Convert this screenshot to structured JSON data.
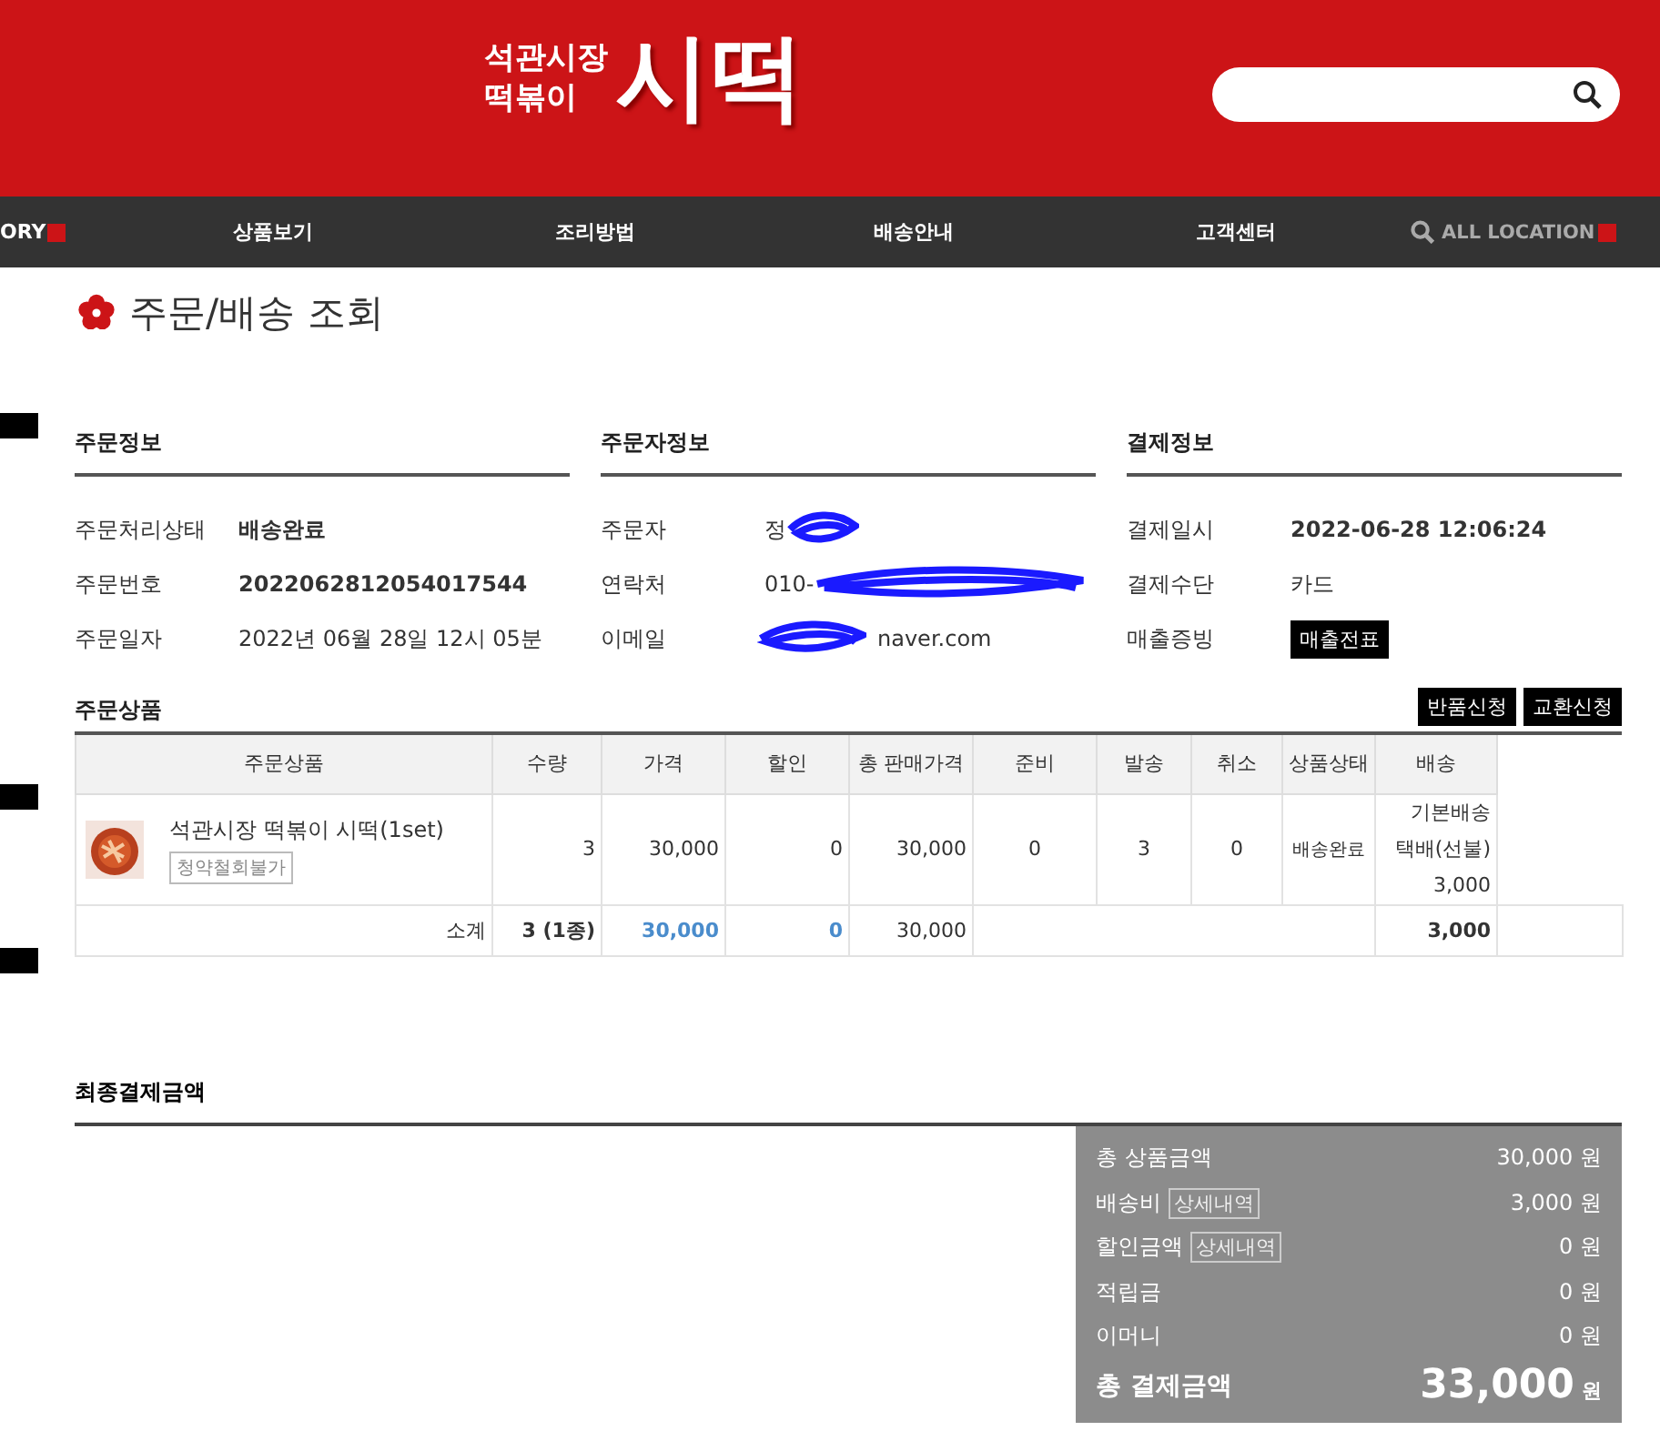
{
  "header": {
    "logo": {
      "small_line_1": "석관시장",
      "small_line_2": "떡볶이",
      "big": "시떡"
    }
  },
  "nav": {
    "left_cut": "ORY",
    "items": [
      "상품보기",
      "조리방법",
      "배송안내",
      "고객센터"
    ],
    "location": "ALL LOCATION"
  },
  "page_title": "주문/배송 조회",
  "info_sections": [
    {
      "title": "주문정보",
      "rows": [
        {
          "label": "주문처리상태",
          "value": "배송완료",
          "kind": "bold"
        },
        {
          "label": "주문번호",
          "value": "2022062812054017544",
          "kind": "bold"
        },
        {
          "label": "주문일자",
          "value": "2022년 06월 28일 12시 05분",
          "kind": "plain"
        }
      ]
    },
    {
      "title": "주문자정보",
      "rows": [
        {
          "label": "주문자",
          "value": "정",
          "kind": "redacted"
        },
        {
          "label": "연락처",
          "value": "010-",
          "kind": "redacted"
        },
        {
          "label": "이메일",
          "value": "naver.com",
          "kind": "redacted_before"
        }
      ]
    },
    {
      "title": "결제정보",
      "rows": [
        {
          "label": "결제일시",
          "value": "2022-06-28 12:06:24",
          "kind": "bold"
        },
        {
          "label": "결제수단",
          "value": "카드",
          "kind": "plain"
        },
        {
          "label": "매출증빙",
          "value": "매출전표",
          "kind": "button"
        }
      ]
    }
  ],
  "products": {
    "title": "주문상품",
    "buttons": [
      "반품신청",
      "교환신청"
    ],
    "columns": [
      "주문상품",
      "수량",
      "가격",
      "할인",
      "총 판매가격",
      "준비",
      "발송",
      "취소",
      "상품상태",
      "배송"
    ],
    "rows": [
      {
        "name": "석관시장 떡볶이 시떡(1set)",
        "tag": "청약철회불가",
        "qty": "3",
        "price": "30,000",
        "discount": "0",
        "total": "30,000",
        "ready": "0",
        "sent": "3",
        "cancel": "0",
        "status": "배송완료",
        "shipping": [
          "기본배송",
          "택배(선불)",
          "3,000"
        ]
      }
    ],
    "subtotal": {
      "label": "소계",
      "qty": "3 (1종)",
      "price": "30,000",
      "discount": "0",
      "total": "30,000",
      "shipping": "3,000"
    }
  },
  "final": {
    "title": "최종결제금액",
    "rows": [
      {
        "label": "총 상품금액",
        "value": "30,000 원"
      },
      {
        "label": "배송비",
        "detail": "상세내역",
        "value": "3,000 원"
      },
      {
        "label": "할인금액",
        "detail": "상세내역",
        "value": "0 원"
      },
      {
        "label": "적립금",
        "value": "0 원"
      },
      {
        "label": "이머니",
        "value": "0 원"
      }
    ],
    "total": {
      "label": "총 결제금액",
      "amount": "33,000",
      "unit": "원"
    }
  }
}
